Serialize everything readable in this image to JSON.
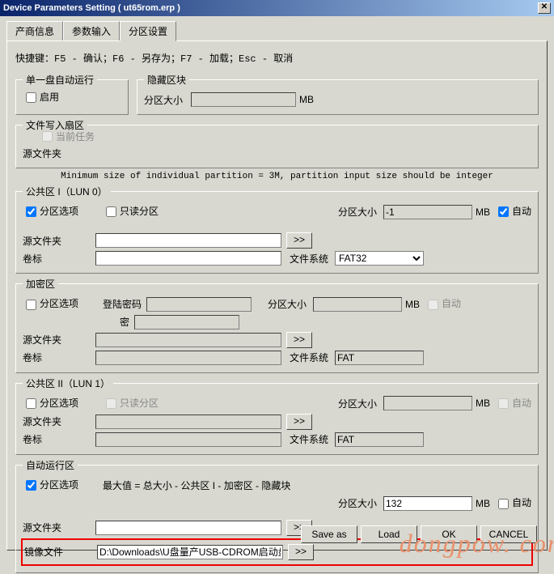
{
  "window": {
    "title": "Device Parameters Setting ( ut65rom.erp )"
  },
  "tabs": {
    "t0": "产商信息",
    "t1": "参数输入",
    "t2": "分区设置"
  },
  "shortcut": "快捷键：F5 - 确认；F6 - 另存为；F7 - 加载；Esc - 取消",
  "group_auto_run_single": {
    "legend": "单一盘自动运行",
    "enable": "启用"
  },
  "group_hidden": {
    "legend": "隐藏区块",
    "size_label": "分区大小",
    "mb": "MB",
    "value": ""
  },
  "group_file_fan": {
    "legend": "文件写入扇区",
    "current_task": "当前任务",
    "src_folder_label": "源文件夹"
  },
  "hint": "Minimum size of individual partition = 3M, partition input size should be integer",
  "pubI": {
    "legend": "公共区 I（LUN 0）",
    "opt": "分区选项",
    "readonly": "只读分区",
    "size_label": "分区大小",
    "size_val": "-1",
    "mb": "MB",
    "auto": "自动",
    "src_folder": "源文件夹",
    "volume": "卷标",
    "fs_label": "文件系统",
    "fs_val": "FAT32"
  },
  "enc": {
    "legend": "加密区",
    "opt": "分区选项",
    "login_pw": "登陆密码",
    "pw2": "密",
    "size_label": "分区大小",
    "mb": "MB",
    "auto": "自动",
    "src_folder": "源文件夹",
    "volume": "卷标",
    "fs_label": "文件系统",
    "fs_val": "FAT"
  },
  "pubII": {
    "legend": "公共区 II（LUN 1）",
    "opt": "分区选项",
    "readonly": "只读分区",
    "size_label": "分区大小",
    "mb": "MB",
    "auto": "自动",
    "src_folder": "源文件夹",
    "volume": "卷标",
    "fs_label": "文件系统",
    "fs_val": "FAT"
  },
  "autorun": {
    "legend": "自动运行区",
    "opt": "分区选项",
    "max_label": "最大值 = 总大小 - 公共区 I - 加密区 - 隐藏块",
    "size_label": "分区大小",
    "size_val": "132",
    "mb": "MB",
    "auto": "自动",
    "src_folder": "源文件夹",
    "image_file": "镜像文件",
    "image_val": "D:\\Downloads\\U盘量产USB-CDROM启动盘"
  },
  "buttons": {
    "saveas": "Save as",
    "load": "Load",
    "ok": "OK",
    "cancel": "CANCEL"
  },
  "browse": ">>",
  "watermark": "dongpow. com"
}
